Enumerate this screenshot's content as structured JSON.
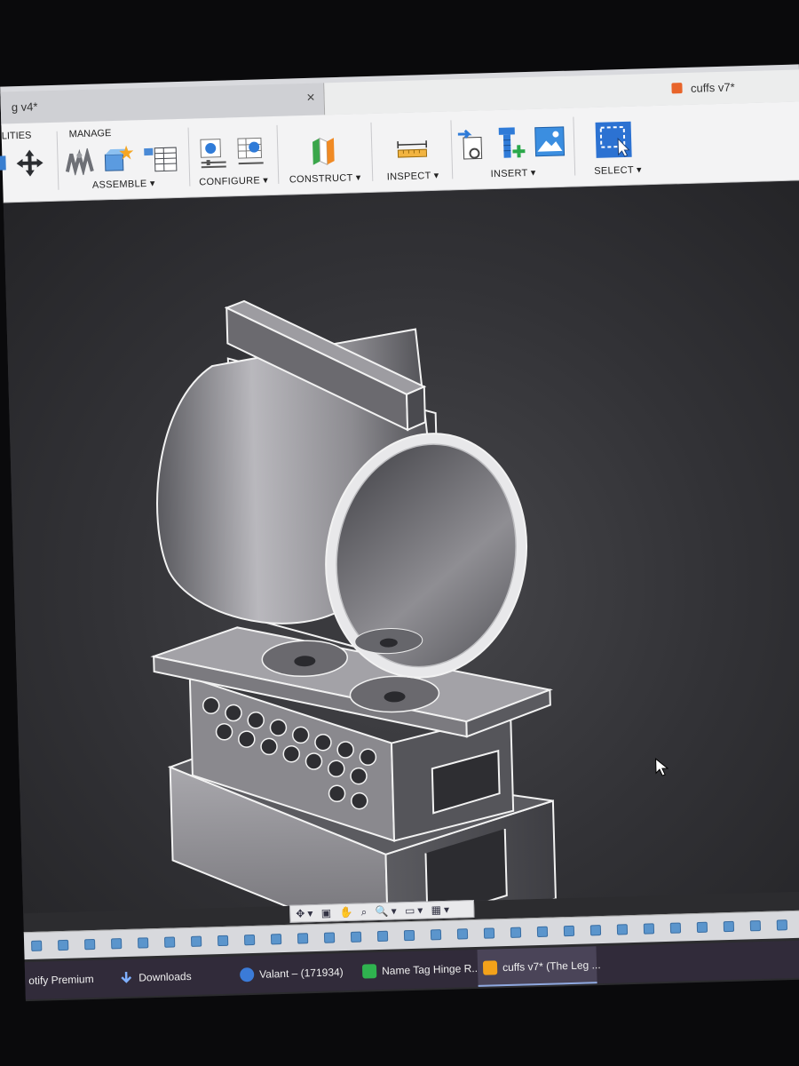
{
  "tabs": [
    {
      "label": "g v4*",
      "close": "×"
    },
    {
      "label": "cuffs v7*"
    }
  ],
  "toolbar": {
    "utilities_label": "LITIES",
    "manage_label": "MANAGE",
    "assemble_label": "ASSEMBLE ▾",
    "configure_label": "CONFIGURE ▾",
    "construct_label": "CONSTRUCT ▾",
    "inspect_label": "INSPECT ▾",
    "insert_label": "INSERT ▾",
    "select_label": "SELECT ▾"
  },
  "navbar": {
    "controls": "✥▾ ▣ ✋ ⌕ 🔍▾ ▭▾ ▦▾ ▤▾"
  },
  "taskbar": {
    "items": [
      {
        "label": "otify Premium"
      },
      {
        "label": "Downloads"
      },
      {
        "label": "Valant – (171934)"
      },
      {
        "label": "Name Tag Hinge R..."
      },
      {
        "label": "cuffs v7* (The Leg ..."
      }
    ]
  },
  "colors": {
    "accent": "#2b6fcf",
    "tab_icon": "#e8642a",
    "viewport": "#323236"
  }
}
